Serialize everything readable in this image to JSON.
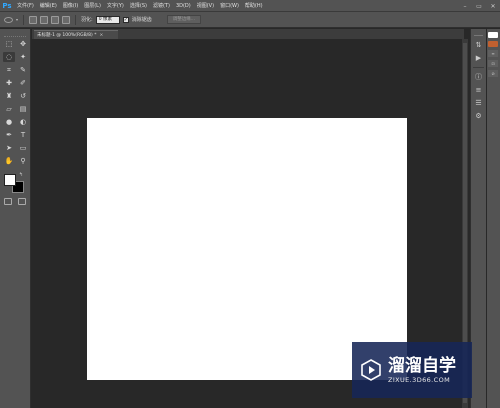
{
  "app": {
    "logo_text": "Ps"
  },
  "menu": {
    "items": [
      "文件(F)",
      "编辑(E)",
      "图像(I)",
      "图层(L)",
      "文字(Y)",
      "选择(S)",
      "滤镜(T)",
      "3D(D)",
      "视图(V)",
      "窗口(W)",
      "帮助(H)"
    ]
  },
  "window_controls": {
    "minimize": "–",
    "restore": "▭",
    "close": "✕"
  },
  "options": {
    "feather_label": "羽化:",
    "feather_value": "0 像素",
    "antialias_label": "消除锯齿",
    "antialias_checked": "✓",
    "refine_button": "调整边缘..."
  },
  "document": {
    "tab_title": "未标题-1 @ 100%(RGB/8) *",
    "tab_close": "×",
    "canvas_color": "#ffffff"
  },
  "swatches": {
    "foreground": "#ffffff",
    "background": "#000000"
  },
  "watermark": {
    "title": "溜溜自学",
    "url": "ZIXUE.3D66.COM"
  }
}
